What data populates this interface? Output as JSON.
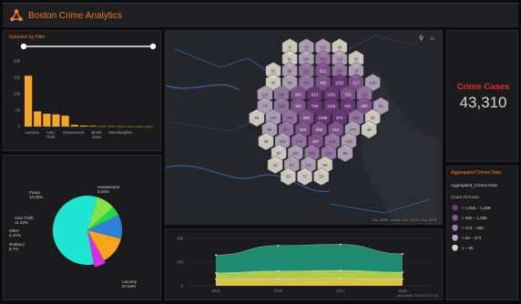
{
  "header": {
    "title": "Boston Crime Analytics",
    "logo_icon": "crime-analytics-logo"
  },
  "bar_chart": {
    "title": "Selection by Filter",
    "chart_data": {
      "type": "bar",
      "categories": [
        "Larceny",
        "Auto Theft",
        "Harassment",
        "Bomb Hoax",
        "Manslaughter"
      ],
      "values": [
        15500,
        4600,
        3900,
        3700,
        3300,
        500,
        300,
        200,
        100,
        80,
        60,
        40,
        30,
        20
      ],
      "yticks": [
        "20k",
        "15k",
        "10k",
        "5k",
        "0"
      ],
      "ylim": [
        0,
        20000
      ],
      "color": "#f2a91f"
    },
    "slider": {
      "track": "#bdbdbd"
    }
  },
  "pie_chart": {
    "chart_data": {
      "type": "pie",
      "slices": [
        {
          "label": "Larceny 57.64%",
          "value": 57.64,
          "color": "#1ee6d2"
        },
        {
          "label": "Robbery 8.7%",
          "value": 8.7,
          "color": "#86e24a"
        },
        {
          "label": "Other 4.41%",
          "value": 4.41,
          "color": "#27d64a"
        },
        {
          "label": "Auto Theft 11.29%",
          "value": 11.29,
          "color": "#2f7fd8"
        },
        {
          "label": "Fraud 12.93%",
          "value": 12.93,
          "color": "#f6a51c"
        },
        {
          "label": "Harassment 5.03%",
          "value": 5.03,
          "color": "#d82de0"
        }
      ]
    }
  },
  "map": {
    "search_icon": "search-icon",
    "home_icon": "home-icon",
    "attribution": "Esri, HERE, Garmin, NGA, USGS | Esri, HERE",
    "bins": [
      {
        "v": "8",
        "c": 0
      },
      {
        "v": "35",
        "c": 1
      },
      {
        "v": "102",
        "c": 1
      },
      {
        "v": "45",
        "c": 0
      },
      {
        "v": "51",
        "c": 0
      },
      {
        "v": "140",
        "c": 1
      },
      {
        "v": "332",
        "c": 2
      },
      {
        "v": "126",
        "c": 1
      },
      {
        "v": "30",
        "c": 0
      },
      {
        "v": "61",
        "c": 0
      },
      {
        "v": "99",
        "c": 1
      },
      {
        "v": "225",
        "c": 2
      },
      {
        "v": "612",
        "c": 3
      },
      {
        "v": "284",
        "c": 2
      },
      {
        "v": "79",
        "c": 1
      },
      {
        "v": "25",
        "c": 0
      },
      {
        "v": "88",
        "c": 1
      },
      {
        "v": "196",
        "c": 2
      },
      {
        "v": "455",
        "c": 3
      },
      {
        "v": "1032",
        "c": 4
      },
      {
        "v": "517",
        "c": 3
      },
      {
        "v": "145",
        "c": 1
      },
      {
        "v": "120",
        "c": 1
      },
      {
        "v": "264",
        "c": 2
      },
      {
        "v": "380",
        "c": 3
      },
      {
        "v": "819",
        "c": 4
      },
      {
        "v": "1351",
        "c": 4
      },
      {
        "v": "703",
        "c": 3
      },
      {
        "v": "210",
        "c": 2
      },
      {
        "v": "73",
        "c": 1
      },
      {
        "v": "188",
        "c": 2
      },
      {
        "v": "402",
        "c": 3
      },
      {
        "v": "726",
        "c": 4
      },
      {
        "v": "1213",
        "c": 4
      },
      {
        "v": "934",
        "c": 4
      },
      {
        "v": "355",
        "c": 3
      },
      {
        "v": "91",
        "c": 1
      },
      {
        "v": "56",
        "c": 0
      },
      {
        "v": "133",
        "c": 1
      },
      {
        "v": "298",
        "c": 2
      },
      {
        "v": "560",
        "c": 3
      },
      {
        "v": "1488",
        "c": 4
      },
      {
        "v": "874",
        "c": 4
      },
      {
        "v": "241",
        "c": 2
      },
      {
        "v": "64",
        "c": 0
      },
      {
        "v": "94",
        "c": 1
      },
      {
        "v": "207",
        "c": 2
      },
      {
        "v": "433",
        "c": 3
      },
      {
        "v": "668",
        "c": 3
      },
      {
        "v": "512",
        "c": 3
      },
      {
        "v": "176",
        "c": 1
      },
      {
        "v": "48",
        "c": 0
      },
      {
        "v": "38",
        "c": 0
      },
      {
        "v": "115",
        "c": 1
      },
      {
        "v": "276",
        "c": 2
      },
      {
        "v": "397",
        "c": 3
      },
      {
        "v": "319",
        "c": 2
      },
      {
        "v": "128",
        "c": 1
      },
      {
        "v": "67",
        "c": 0
      },
      {
        "v": "152",
        "c": 1
      },
      {
        "v": "231",
        "c": 2
      },
      {
        "v": "184",
        "c": 2
      },
      {
        "v": "86",
        "c": 1
      },
      {
        "v": "42",
        "c": 0
      },
      {
        "v": "97",
        "c": 1
      },
      {
        "v": "141",
        "c": 1
      },
      {
        "v": "59",
        "c": 0
      },
      {
        "v": "29",
        "c": 0
      },
      {
        "v": "71",
        "c": 0
      },
      {
        "v": "33",
        "c": 0
      }
    ],
    "colors": [
      "#d8d4c8",
      "#b7a6bd",
      "#9c7aa8",
      "#83578f",
      "#6a3a7a"
    ]
  },
  "line_chart": {
    "chart_data": {
      "type": "area",
      "x": [
        "2015",
        "2016",
        "2017",
        "2018"
      ],
      "yticks": [
        "40k",
        "20k",
        "0"
      ],
      "ylim": [
        0,
        40000
      ],
      "series": [
        {
          "values": [
            26000,
            34000,
            35000,
            27000
          ],
          "color": "#1f9e7e"
        },
        {
          "values": [
            11000,
            12500,
            13000,
            11500
          ],
          "color": "#c9d449"
        },
        {
          "values": [
            5500,
            6000,
            6200,
            5600
          ],
          "color": "#e0c04a"
        }
      ]
    },
    "footnote": "Last update: 2018-10-15 11:46"
  },
  "indicator": {
    "title": "Crime Cases",
    "value": "43,310"
  },
  "legend": {
    "title": "Aggregated Crimes Data",
    "subtitle": "Aggregated_Crimes Data",
    "field": "Count of Points",
    "items": [
      {
        "label": "> 1,056 – 1,489",
        "color": "#6a3a7a"
      },
      {
        "label": "> 680 – 1,056",
        "color": "#83578f"
      },
      {
        "label": "> 374 – 680",
        "color": "#9c7aa8"
      },
      {
        "label": "> 95 – 374",
        "color": "#b7a6bd"
      },
      {
        "label": "1 – 95",
        "color": "#d8d4c8"
      }
    ]
  }
}
